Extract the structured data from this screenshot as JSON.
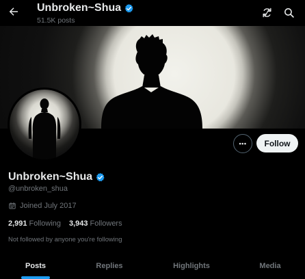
{
  "header": {
    "title": "Unbroken~Shua",
    "post_count": "51.5K posts",
    "back_icon": "arrow-left-icon",
    "refresh_icon": "refresh-icon",
    "search_icon": "search-icon"
  },
  "profile": {
    "display_name": "Unbroken~Shua",
    "handle": "@unbroken_shua",
    "verified": true,
    "joined": "Joined July 2017",
    "following_count": "2,991",
    "following_label": "Following",
    "followers_count": "3,943",
    "followers_label": "Followers",
    "not_followed_text": "Not followed by anyone you're following"
  },
  "actions": {
    "more_label": "•••",
    "follow_label": "Follow"
  },
  "tabs": [
    {
      "label": "Posts",
      "active": true
    },
    {
      "label": "Replies",
      "active": false
    },
    {
      "label": "Highlights",
      "active": false
    },
    {
      "label": "Media",
      "active": false
    }
  ],
  "colors": {
    "background": "#000000",
    "text_primary": "#e7e9ea",
    "text_secondary": "#71767b",
    "accent": "#1d9bf0",
    "follow_button_bg": "#eff3f4"
  }
}
